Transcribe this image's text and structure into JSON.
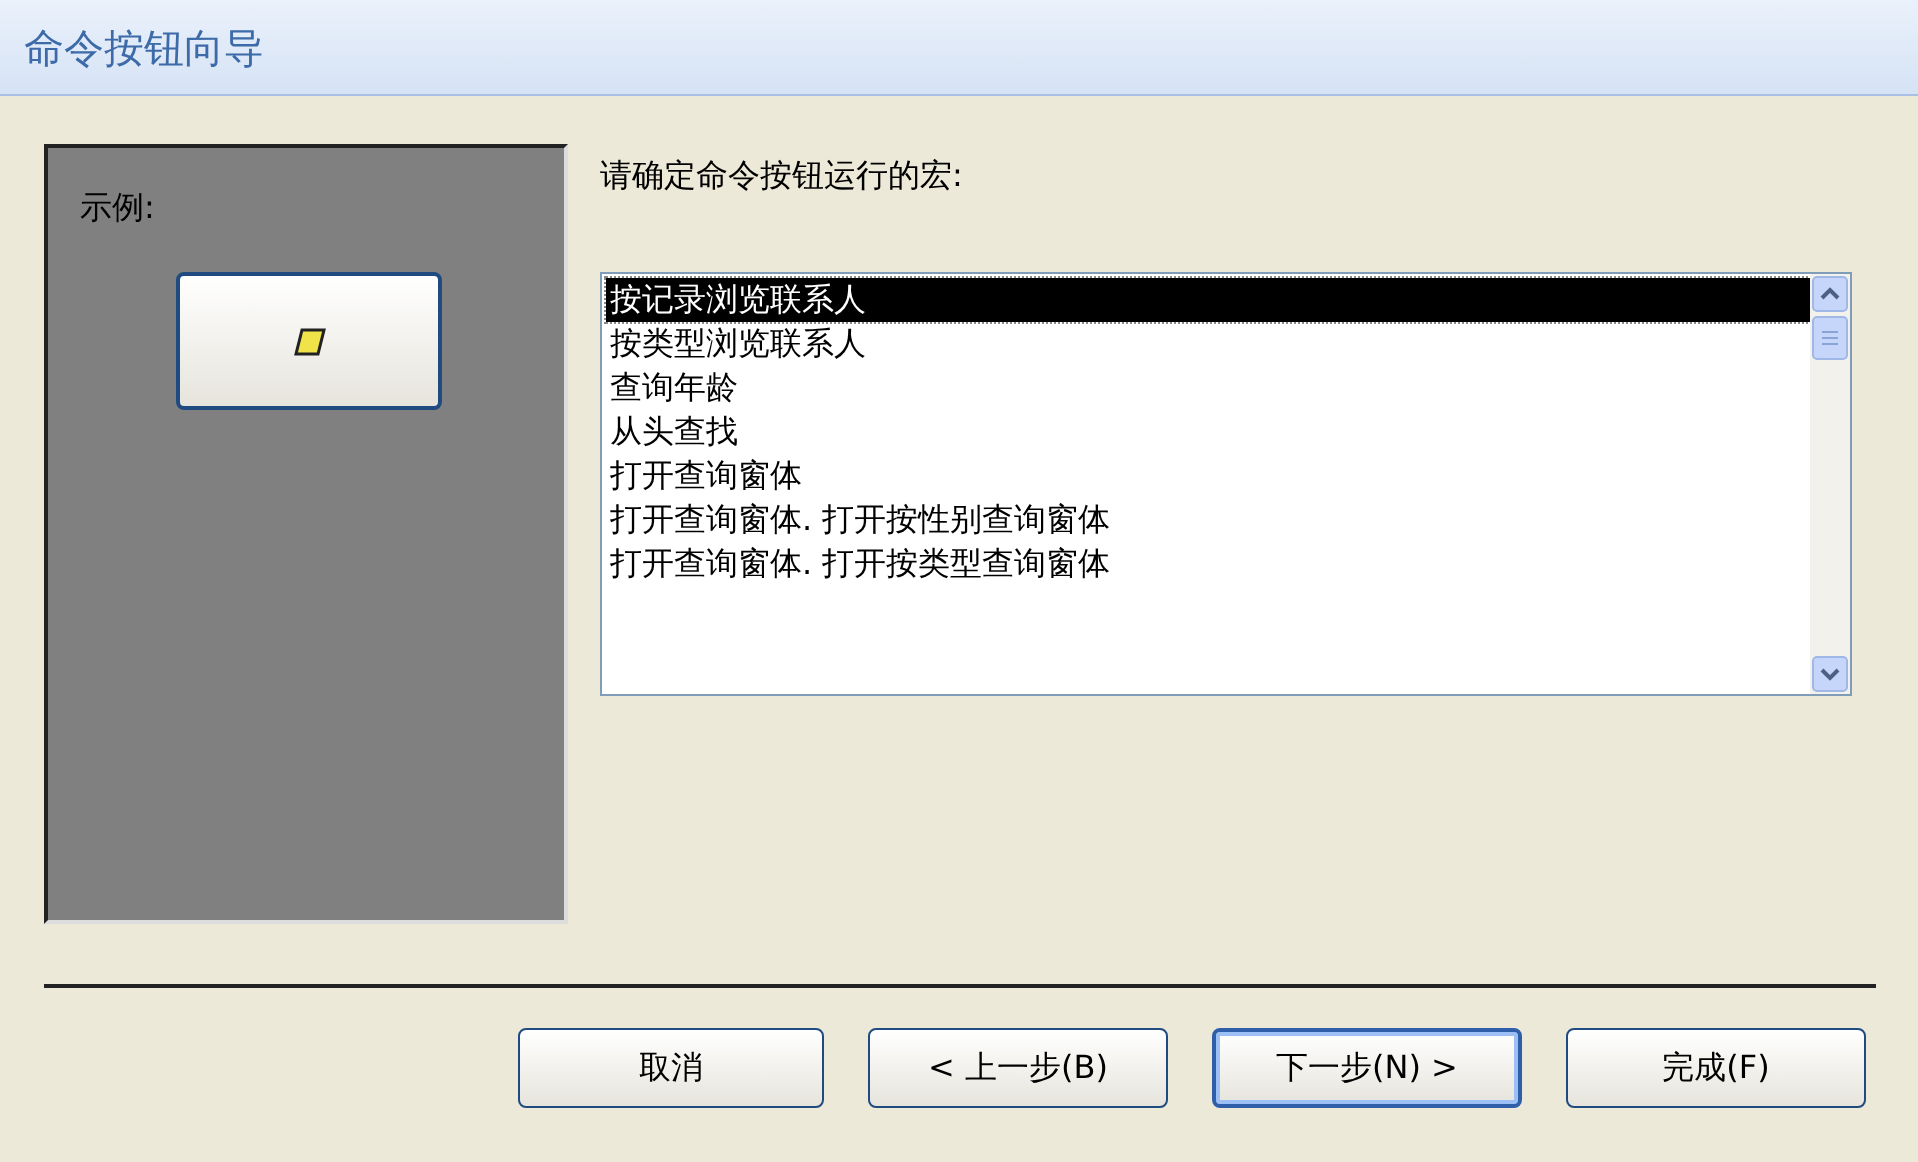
{
  "window": {
    "title": "命令按钮向导"
  },
  "sample": {
    "label": "示例:"
  },
  "prompt": "请确定命令按钮运行的宏:",
  "macros": [
    {
      "label": "按记录浏览联系人",
      "selected": true
    },
    {
      "label": "按类型浏览联系人",
      "selected": false
    },
    {
      "label": "查询年龄",
      "selected": false
    },
    {
      "label": "从头查找",
      "selected": false
    },
    {
      "label": "打开查询窗体",
      "selected": false
    },
    {
      "label": "打开查询窗体. 打开按性别查询窗体",
      "selected": false
    },
    {
      "label": "打开查询窗体. 打开按类型查询窗体",
      "selected": false
    }
  ],
  "buttons": [
    {
      "label": "取消",
      "default": false
    },
    {
      "label": "< 上一步(B)",
      "default": false
    },
    {
      "label": "下一步(N) >",
      "default": true
    },
    {
      "label": "完成(F)",
      "default": false
    }
  ]
}
